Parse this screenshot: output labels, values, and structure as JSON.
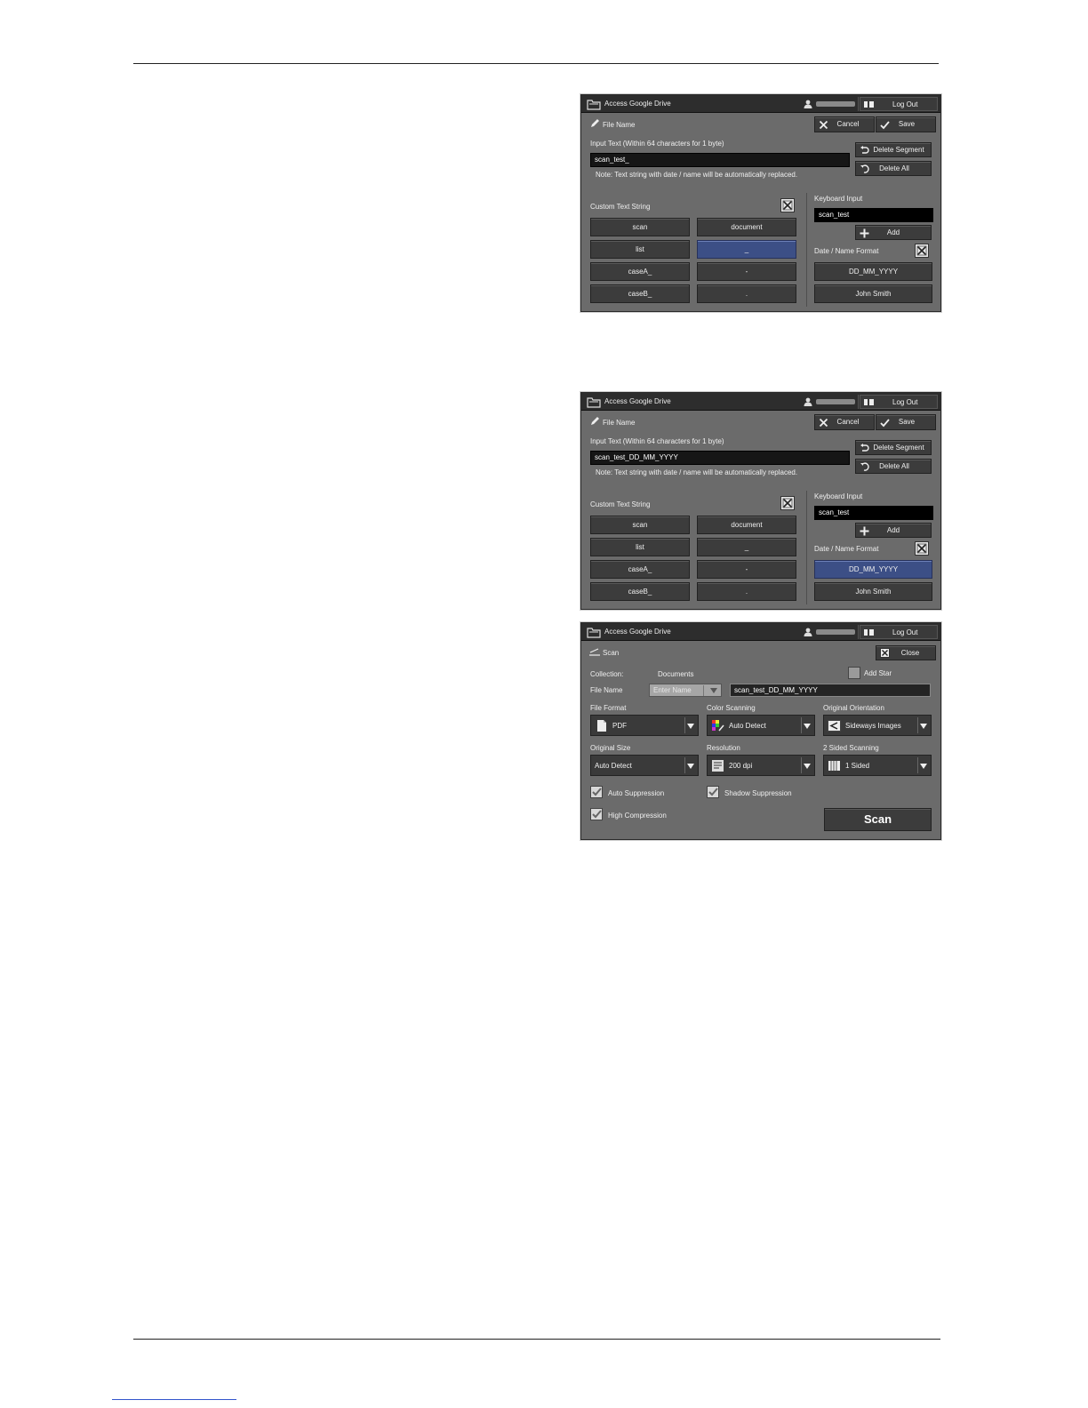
{
  "screen1": {
    "app_title": "Access Google Drive",
    "logout_label": "Log Out",
    "panel_title": "File Name",
    "cancel_label": "Cancel",
    "save_label": "Save",
    "input_label": "Input Text (Within 64 characters for 1 byte)",
    "input_value": "scan_test_",
    "note": "Note: Text string with date / name will be automatically replaced.",
    "delete_segment_label": "Delete Segment",
    "delete_all_label": "Delete All",
    "custom_text_label": "Custom Text String",
    "custom_items": [
      "scan",
      "document",
      "list",
      "_",
      "caseA_",
      "-",
      "caseB_",
      "."
    ],
    "selected_custom_index": 3,
    "keyboard_input_label": "Keyboard Input",
    "keyboard_input_value": "scan_test",
    "add_label": "Add",
    "date_name_label": "Date / Name Format",
    "date_format": "DD_MM_YYYY",
    "name_format": "John Smith",
    "selected_right_index": -1
  },
  "screen2": {
    "app_title": "Access Google Drive",
    "logout_label": "Log Out",
    "panel_title": "File Name",
    "cancel_label": "Cancel",
    "save_label": "Save",
    "input_label": "Input Text (Within 64 characters for 1 byte)",
    "input_value": "scan_test_DD_MM_YYYY",
    "note": "Note: Text string with date / name will be automatically replaced.",
    "delete_segment_label": "Delete Segment",
    "delete_all_label": "Delete All",
    "custom_text_label": "Custom Text String",
    "custom_items": [
      "scan",
      "document",
      "list",
      "_",
      "caseA_",
      "-",
      "caseB_",
      "."
    ],
    "selected_custom_index": -1,
    "keyboard_input_label": "Keyboard Input",
    "keyboard_input_value": "scan_test",
    "add_label": "Add",
    "date_name_label": "Date / Name Format",
    "date_format": "DD_MM_YYYY",
    "name_format": "John Smith",
    "selected_right_index": 0
  },
  "screen3": {
    "app_title": "Access Google Drive",
    "logout_label": "Log Out",
    "panel_title": "Scan",
    "close_label": "Close",
    "collection_label": "Collection:",
    "collection_value": "Documents",
    "add_star_label": "Add Star",
    "file_name_label": "File Name",
    "enter_name_placeholder": "Enter Name",
    "file_name_value": "scan_test_DD_MM_YYYY",
    "file_format_label": "File Format",
    "file_format_value": "PDF",
    "color_scanning_label": "Color Scanning",
    "color_scanning_value": "Auto Detect",
    "orientation_label": "Original Orientation",
    "orientation_value": "Sideways Images",
    "original_size_label": "Original Size",
    "original_size_value": "Auto Detect",
    "resolution_label": "Resolution",
    "resolution_value": "200 dpi",
    "two_sided_label": "2 Sided Scanning",
    "two_sided_value": "1 Sided",
    "auto_suppression_label": "Auto Suppression",
    "shadow_suppression_label": "Shadow Suppression",
    "high_compression_label": "High Compression",
    "scan_button_label": "Scan"
  }
}
